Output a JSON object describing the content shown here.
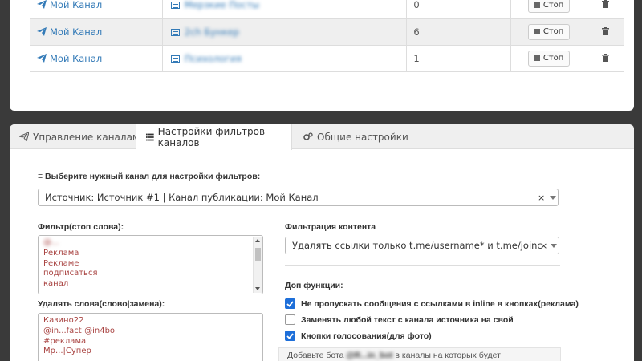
{
  "channels_table": {
    "rows": [
      {
        "channel": "Мой Канал",
        "source": "Мерзкие Посты",
        "count": "0",
        "stop_label": "Стоп"
      },
      {
        "channel": "Мой Канал",
        "source": "2ch Бункер",
        "count": "6",
        "stop_label": "Стоп"
      },
      {
        "channel": "Мой Канал",
        "source": "Психология",
        "count": "1",
        "stop_label": "Стоп"
      }
    ]
  },
  "tabs": [
    {
      "label": "Управление каналами",
      "icon": "telegram-icon"
    },
    {
      "label": "Настройки фильтров каналов",
      "icon": "list-icon"
    },
    {
      "label": "Общие настройки",
      "icon": "gears-icon"
    }
  ],
  "filters": {
    "choose_label": "≡ Выберите нужный канал для настройки фильтров:",
    "channel_select": "Источник: Источник #1 | Канал публикации: Мой Канал",
    "stop_words_label": "Фильтр(стоп слова):",
    "stop_words": [
      "@...",
      "Реклама",
      "Рекламе",
      "подписаться",
      "канал"
    ],
    "replace_label": "Удалять слова(слово|замена):",
    "replace_words": [
      "Казино22",
      "@in...fact|@in4bo",
      "#реклама",
      "Мр...|Супер"
    ],
    "content_label": "Фильтрация контента",
    "content_select": "Удалять ссылки только t.me/username* и t.me/joinchat/XX...",
    "extra_label": "Доп функции:",
    "options": [
      {
        "label": "Не пропускать сообщения с ссылками в inline в кнопках(реклама)",
        "checked": true
      },
      {
        "label": "Заменять любой текст с канала источника на свой",
        "checked": false
      },
      {
        "label": "Кнопки голосования(для фото)",
        "checked": true
      }
    ],
    "hint_prefix": "Добавьте бота ",
    "hint_bot": "@R...in_bot",
    "hint_suffix": " в каналы на которых будет публиковаться"
  },
  "colors": {
    "link": "#337ab7",
    "accent": "#1e6fd9",
    "word_red": "#a94442"
  }
}
